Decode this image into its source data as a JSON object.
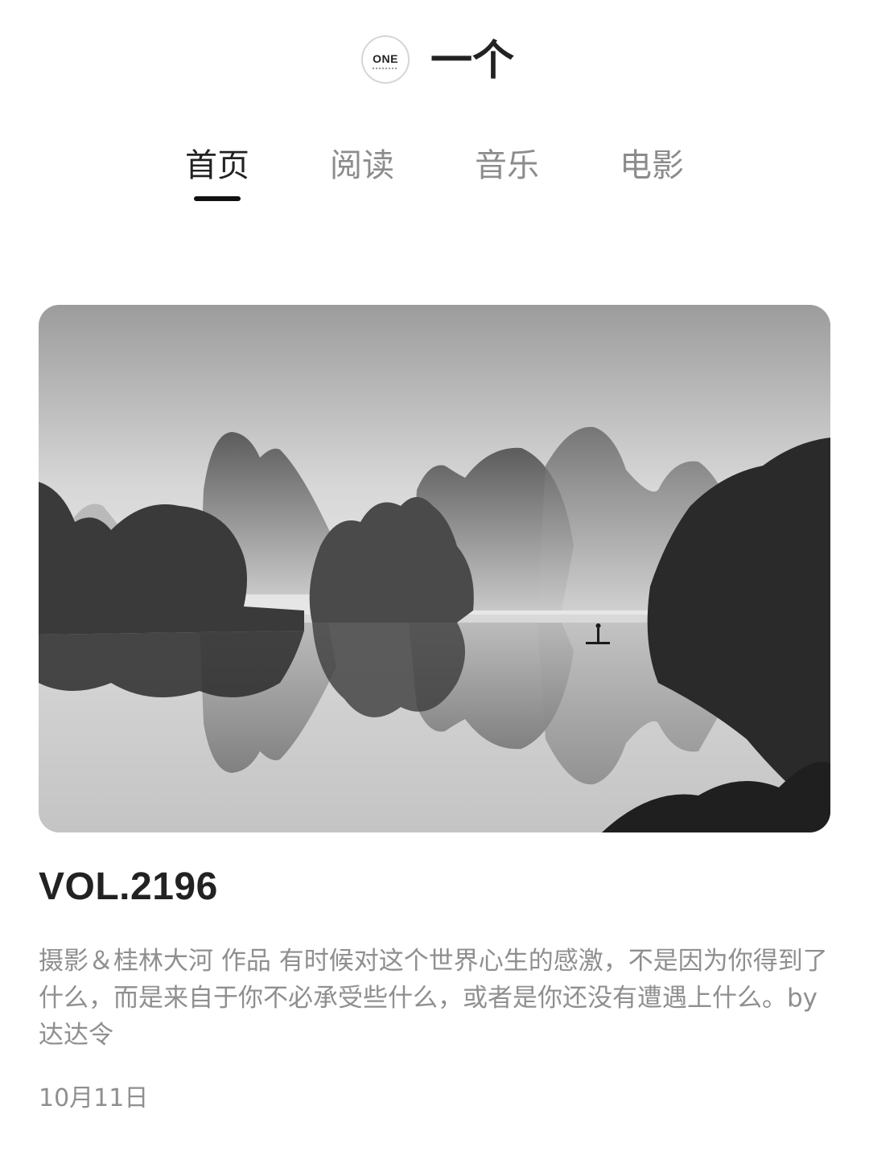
{
  "header": {
    "logo_text": "ONE",
    "title": "一个"
  },
  "tabs": [
    {
      "label": "首页",
      "active": true
    },
    {
      "label": "阅读",
      "active": false
    },
    {
      "label": "音乐",
      "active": false
    },
    {
      "label": "电影",
      "active": false
    }
  ],
  "card": {
    "image_subject": "black-and-white photo of Guilin karst mountains reflected in a misty river with a lone fisherman on a bamboo raft",
    "volume": "VOL.2196",
    "description": "摄影＆桂林大河 作品 有时候对这个世界心生的感激，不是因为你得到了什么，而是来自于你不必承受些什么，或者是你还没有遭遇上什么。by 达达令",
    "date": "10月11日"
  },
  "colors": {
    "text_primary": "#222222",
    "text_secondary": "#8f8f8f",
    "tab_inactive": "#8c8c8c",
    "indicator": "#111111",
    "background": "#ffffff"
  }
}
